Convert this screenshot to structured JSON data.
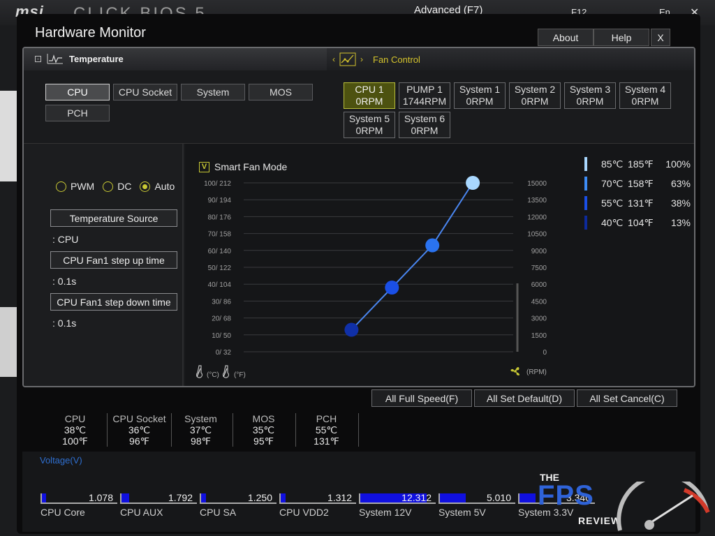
{
  "background": {
    "logo": "msi",
    "sub_title": "CLICK BIOS 5",
    "mode": "Advanced (F7)",
    "f12": "F12",
    "lang": "En",
    "close": "✕"
  },
  "window": {
    "title": "Hardware Monitor",
    "about": "About",
    "help": "Help",
    "close": "X"
  },
  "temperature": {
    "header": "Temperature",
    "sensors": [
      "CPU",
      "CPU Socket",
      "System",
      "MOS",
      "PCH"
    ],
    "active_sensor": "CPU"
  },
  "fan_control": {
    "header": "Fan Control",
    "fans": [
      {
        "name": "CPU 1",
        "rpm": "0RPM",
        "active": true
      },
      {
        "name": "PUMP 1",
        "rpm": "1744RPM"
      },
      {
        "name": "System 1",
        "rpm": "0RPM"
      },
      {
        "name": "System 2",
        "rpm": "0RPM"
      },
      {
        "name": "System 3",
        "rpm": "0RPM"
      },
      {
        "name": "System 4",
        "rpm": "0RPM"
      },
      {
        "name": "System 5",
        "rpm": "0RPM"
      },
      {
        "name": "System 6",
        "rpm": "0RPM"
      }
    ]
  },
  "control": {
    "modes": [
      "PWM",
      "DC",
      "Auto"
    ],
    "selected_mode": "Auto",
    "temp_source_label": "Temperature Source",
    "temp_source_value": ": CPU",
    "step_up_label": "CPU Fan1 step up time",
    "step_up_value": ": 0.1s",
    "step_down_label": "CPU Fan1 step down time",
    "step_down_value": ": 0.1s"
  },
  "smart_fan": {
    "label": "Smart Fan Mode",
    "checked": true,
    "check_mark": "V"
  },
  "chart_data": {
    "type": "line",
    "left_axis_ticks": [
      "100/ 212",
      "90/ 194",
      "80/ 176",
      "70/ 158",
      "60/ 140",
      "50/ 122",
      "40/ 104",
      "30/  86",
      "20/  68",
      "10/  50",
      "0/  32"
    ],
    "right_axis_ticks": [
      "15000",
      "13500",
      "12000",
      "10500",
      "9000",
      "7500",
      "6000",
      "4500",
      "3000",
      "1500",
      "0"
    ],
    "x_unit_c": "(°C)",
    "x_unit_f": "(°F)",
    "y_unit": "(RPM)",
    "xlim": [
      0,
      100
    ],
    "ylim": [
      0,
      100
    ],
    "points": [
      {
        "temp_c": 40,
        "fan_pct": 13,
        "color": "#1030a8"
      },
      {
        "temp_c": 55,
        "fan_pct": 38,
        "color": "#1a4fe6"
      },
      {
        "temp_c": 70,
        "fan_pct": 63,
        "color": "#2a73f0"
      },
      {
        "temp_c": 85,
        "fan_pct": 100,
        "color": "#a9d8ff"
      }
    ],
    "legend": [
      {
        "c": "85℃",
        "f": "185℉",
        "pct": "100%",
        "color": "#a9d8ff"
      },
      {
        "c": "70℃",
        "f": "158℉",
        "pct": "63%",
        "color": "#3d8cf5"
      },
      {
        "c": "55℃",
        "f": "131℉",
        "pct": "38%",
        "color": "#1a4fe6"
      },
      {
        "c": "40℃",
        "f": "104℉",
        "pct": "13%",
        "color": "#0d2a9a"
      }
    ]
  },
  "actions": {
    "full_speed": "All Full Speed(F)",
    "set_default": "All Set Default(D)",
    "set_cancel": "All Set Cancel(C)"
  },
  "temp_readouts": [
    {
      "name": "CPU",
      "c": "38℃",
      "f": "100℉"
    },
    {
      "name": "CPU Socket",
      "c": "36℃",
      "f": "96℉"
    },
    {
      "name": "System",
      "c": "37℃",
      "f": "98℉"
    },
    {
      "name": "MOS",
      "c": "35℃",
      "f": "95℉"
    },
    {
      "name": "PCH",
      "c": "55℃",
      "f": "131℉"
    }
  ],
  "voltage": {
    "title": "Voltage(V)",
    "items": [
      {
        "name": "CPU Core",
        "value": "1.078",
        "fill": 0.06
      },
      {
        "name": "CPU AUX",
        "value": "1.792",
        "fill": 0.1
      },
      {
        "name": "CPU SA",
        "value": "1.250",
        "fill": 0.07
      },
      {
        "name": "CPU VDD2",
        "value": "1.312",
        "fill": 0.07
      },
      {
        "name": "System 12V",
        "value": "12.312",
        "fill": 0.9
      },
      {
        "name": "System 5V",
        "value": "5.010",
        "fill": 0.35
      },
      {
        "name": "System 3.3V",
        "value": "3.340",
        "fill": 0.22
      }
    ]
  },
  "watermark": {
    "the": "THE",
    "fps": "FPS",
    "review": "REVIEW"
  }
}
